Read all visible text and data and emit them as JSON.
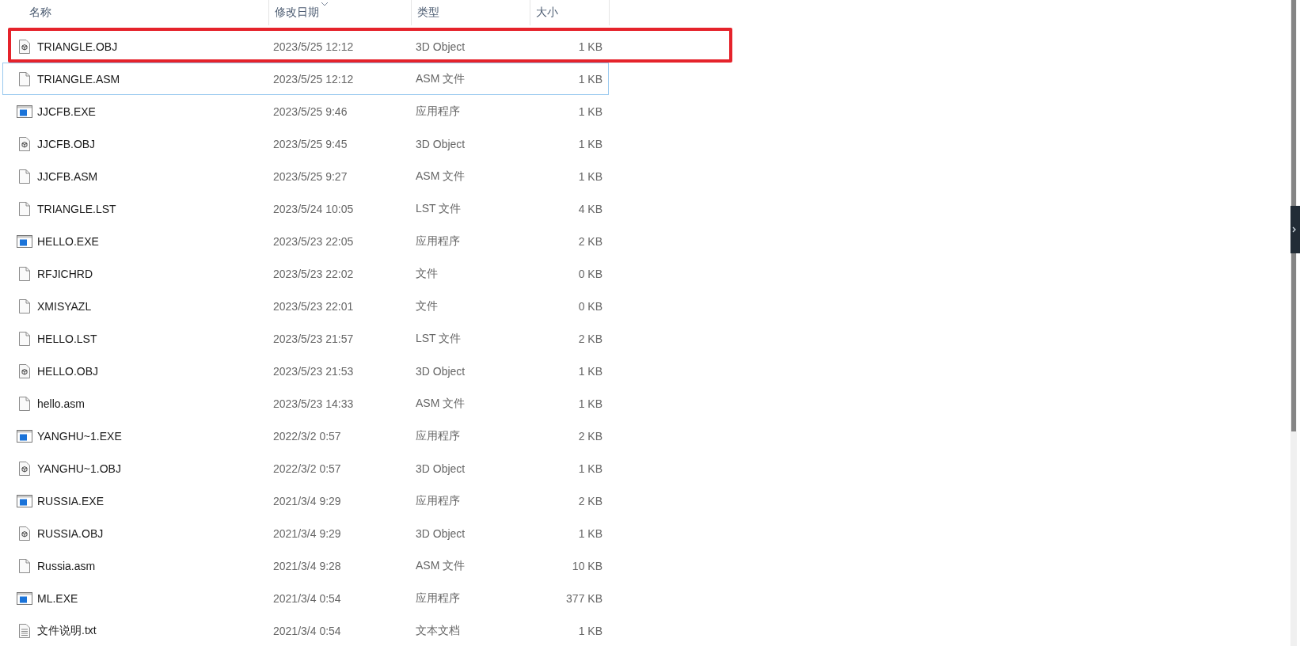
{
  "columns": [
    {
      "label": "名称",
      "sorted": false
    },
    {
      "label": "修改日期",
      "sorted": true
    },
    {
      "label": "类型",
      "sorted": false
    },
    {
      "label": "大小",
      "sorted": false
    }
  ],
  "rows": [
    {
      "name": "TRIANGLE.OBJ",
      "date": "2023/5/25 12:12",
      "type": "3D Object",
      "size": "1 KB",
      "kind": "obj",
      "highlighted": true,
      "focused": false
    },
    {
      "name": "TRIANGLE.ASM",
      "date": "2023/5/25 12:12",
      "type": "ASM 文件",
      "size": "1 KB",
      "kind": "file",
      "highlighted": false,
      "focused": true
    },
    {
      "name": "JJCFB.EXE",
      "date": "2023/5/25 9:46",
      "type": "应用程序",
      "size": "1 KB",
      "kind": "exe",
      "highlighted": false,
      "focused": false
    },
    {
      "name": "JJCFB.OBJ",
      "date": "2023/5/25 9:45",
      "type": "3D Object",
      "size": "1 KB",
      "kind": "obj",
      "highlighted": false,
      "focused": false
    },
    {
      "name": "JJCFB.ASM",
      "date": "2023/5/25 9:27",
      "type": "ASM 文件",
      "size": "1 KB",
      "kind": "file",
      "highlighted": false,
      "focused": false
    },
    {
      "name": "TRIANGLE.LST",
      "date": "2023/5/24 10:05",
      "type": "LST 文件",
      "size": "4 KB",
      "kind": "file",
      "highlighted": false,
      "focused": false
    },
    {
      "name": "HELLO.EXE",
      "date": "2023/5/23 22:05",
      "type": "应用程序",
      "size": "2 KB",
      "kind": "exe",
      "highlighted": false,
      "focused": false
    },
    {
      "name": "RFJICHRD",
      "date": "2023/5/23 22:02",
      "type": "文件",
      "size": "0 KB",
      "kind": "file",
      "highlighted": false,
      "focused": false
    },
    {
      "name": "XMISYAZL",
      "date": "2023/5/23 22:01",
      "type": "文件",
      "size": "0 KB",
      "kind": "file",
      "highlighted": false,
      "focused": false
    },
    {
      "name": "HELLO.LST",
      "date": "2023/5/23 21:57",
      "type": "LST 文件",
      "size": "2 KB",
      "kind": "file",
      "highlighted": false,
      "focused": false
    },
    {
      "name": "HELLO.OBJ",
      "date": "2023/5/23 21:53",
      "type": "3D Object",
      "size": "1 KB",
      "kind": "obj",
      "highlighted": false,
      "focused": false
    },
    {
      "name": "hello.asm",
      "date": "2023/5/23 14:33",
      "type": "ASM 文件",
      "size": "1 KB",
      "kind": "file",
      "highlighted": false,
      "focused": false
    },
    {
      "name": "YANGHU~1.EXE",
      "date": "2022/3/2 0:57",
      "type": "应用程序",
      "size": "2 KB",
      "kind": "exe",
      "highlighted": false,
      "focused": false
    },
    {
      "name": "YANGHU~1.OBJ",
      "date": "2022/3/2 0:57",
      "type": "3D Object",
      "size": "1 KB",
      "kind": "obj",
      "highlighted": false,
      "focused": false
    },
    {
      "name": "RUSSIA.EXE",
      "date": "2021/3/4 9:29",
      "type": "应用程序",
      "size": "2 KB",
      "kind": "exe",
      "highlighted": false,
      "focused": false
    },
    {
      "name": "RUSSIA.OBJ",
      "date": "2021/3/4 9:29",
      "type": "3D Object",
      "size": "1 KB",
      "kind": "obj",
      "highlighted": false,
      "focused": false
    },
    {
      "name": "Russia.asm",
      "date": "2021/3/4 9:28",
      "type": "ASM 文件",
      "size": "10 KB",
      "kind": "file",
      "highlighted": false,
      "focused": false
    },
    {
      "name": "ML.EXE",
      "date": "2021/3/4 0:54",
      "type": "应用程序",
      "size": "377 KB",
      "kind": "exe",
      "highlighted": false,
      "focused": false
    },
    {
      "name": "文件说明.txt",
      "date": "2021/3/4 0:54",
      "type": "文本文档",
      "size": "1 KB",
      "kind": "txt",
      "highlighted": false,
      "focused": false
    }
  ]
}
